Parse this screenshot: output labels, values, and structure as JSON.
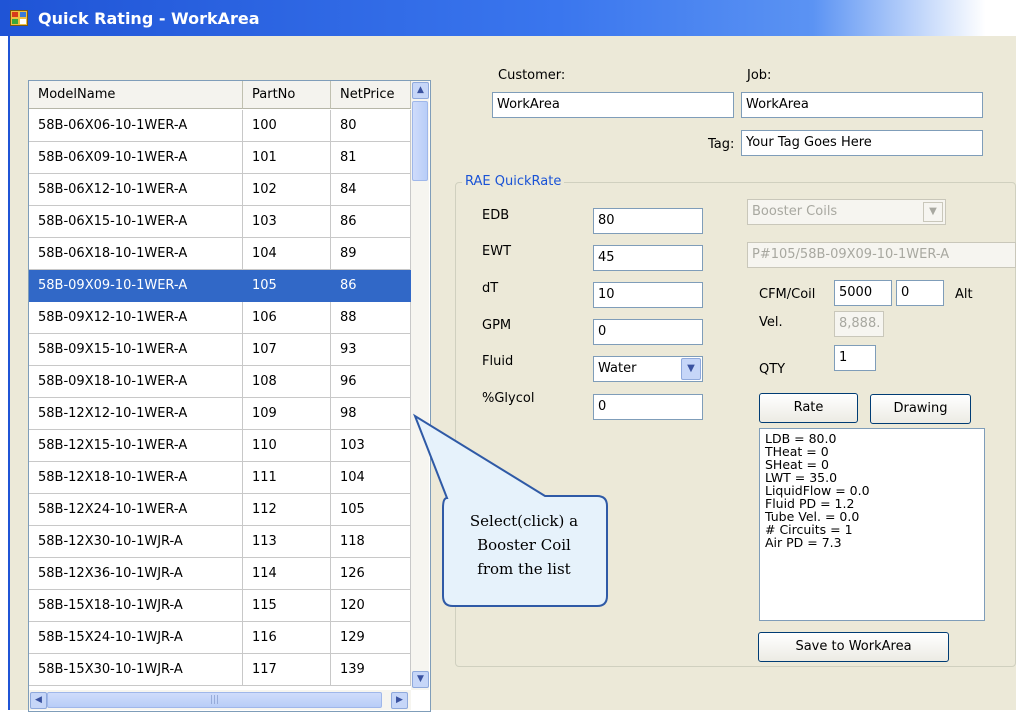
{
  "window": {
    "title": "Quick Rating - WorkArea"
  },
  "grid": {
    "columns": [
      "ModelName",
      "PartNo",
      "NetPrice"
    ],
    "selected_index": 5,
    "rows": [
      [
        "58B-06X06-10-1WER-A",
        "100",
        "80"
      ],
      [
        "58B-06X09-10-1WER-A",
        "101",
        "81"
      ],
      [
        "58B-06X12-10-1WER-A",
        "102",
        "84"
      ],
      [
        "58B-06X15-10-1WER-A",
        "103",
        "86"
      ],
      [
        "58B-06X18-10-1WER-A",
        "104",
        "89"
      ],
      [
        "58B-09X09-10-1WER-A",
        "105",
        "86"
      ],
      [
        "58B-09X12-10-1WER-A",
        "106",
        "88"
      ],
      [
        "58B-09X15-10-1WER-A",
        "107",
        "93"
      ],
      [
        "58B-09X18-10-1WER-A",
        "108",
        "96"
      ],
      [
        "58B-12X12-10-1WER-A",
        "109",
        "98"
      ],
      [
        "58B-12X15-10-1WER-A",
        "110",
        "103"
      ],
      [
        "58B-12X18-10-1WER-A",
        "111",
        "104"
      ],
      [
        "58B-12X24-10-1WER-A",
        "112",
        "105"
      ],
      [
        "58B-12X30-10-1WJR-A",
        "113",
        "118"
      ],
      [
        "58B-12X36-10-1WJR-A",
        "114",
        "126"
      ],
      [
        "58B-15X18-10-1WJR-A",
        "115",
        "120"
      ],
      [
        "58B-15X24-10-1WJR-A",
        "116",
        "129"
      ],
      [
        "58B-15X30-10-1WJR-A",
        "117",
        "139"
      ]
    ]
  },
  "header": {
    "customer_label": "Customer:",
    "customer_value": "WorkArea",
    "job_label": "Job:",
    "job_value": "WorkArea",
    "tag_label": "Tag:",
    "tag_value": "Your Tag Goes Here"
  },
  "quickrate": {
    "group_title": "RAE QuickRate",
    "edb_label": "EDB",
    "edb_value": "80",
    "ewt_label": "EWT",
    "ewt_value": "45",
    "dt_label": "dT",
    "dt_value": "10",
    "gpm_label": "GPM",
    "gpm_value": "0",
    "fluid_label": "Fluid",
    "fluid_value": "Water",
    "glycol_label": "%Glycol",
    "glycol_value": "0",
    "coil_type_value": "Booster Coils",
    "part_desc_value": "P#105/58B-09X09-10-1WER-A",
    "cfm_label": "CFM/Coil",
    "cfm_value": "5000",
    "alt_value": "0",
    "alt_label": "Alt",
    "vel_label": "Vel.",
    "vel_value": "8,888.",
    "qty_label": "QTY",
    "qty_value": "1",
    "rate_button": "Rate",
    "drawing_button": "Drawing",
    "save_button": "Save to WorkArea",
    "results": [
      "LDB = 80.0",
      "THeat = 0",
      "SHeat = 0",
      "LWT = 35.0",
      "LiquidFlow = 0.0",
      "Fluid PD = 1.2",
      "Tube Vel. = 0.0",
      "# Circuits = 1",
      "Air PD = 7.3"
    ]
  },
  "callout": {
    "lines": [
      "Select(click) a",
      "Booster Coil",
      "from the list"
    ]
  },
  "colors": {
    "title_bar": "#1f54d6",
    "selection": "#3168c7",
    "group_title": "#1a53d6",
    "form_bg": "#ece9d8"
  }
}
